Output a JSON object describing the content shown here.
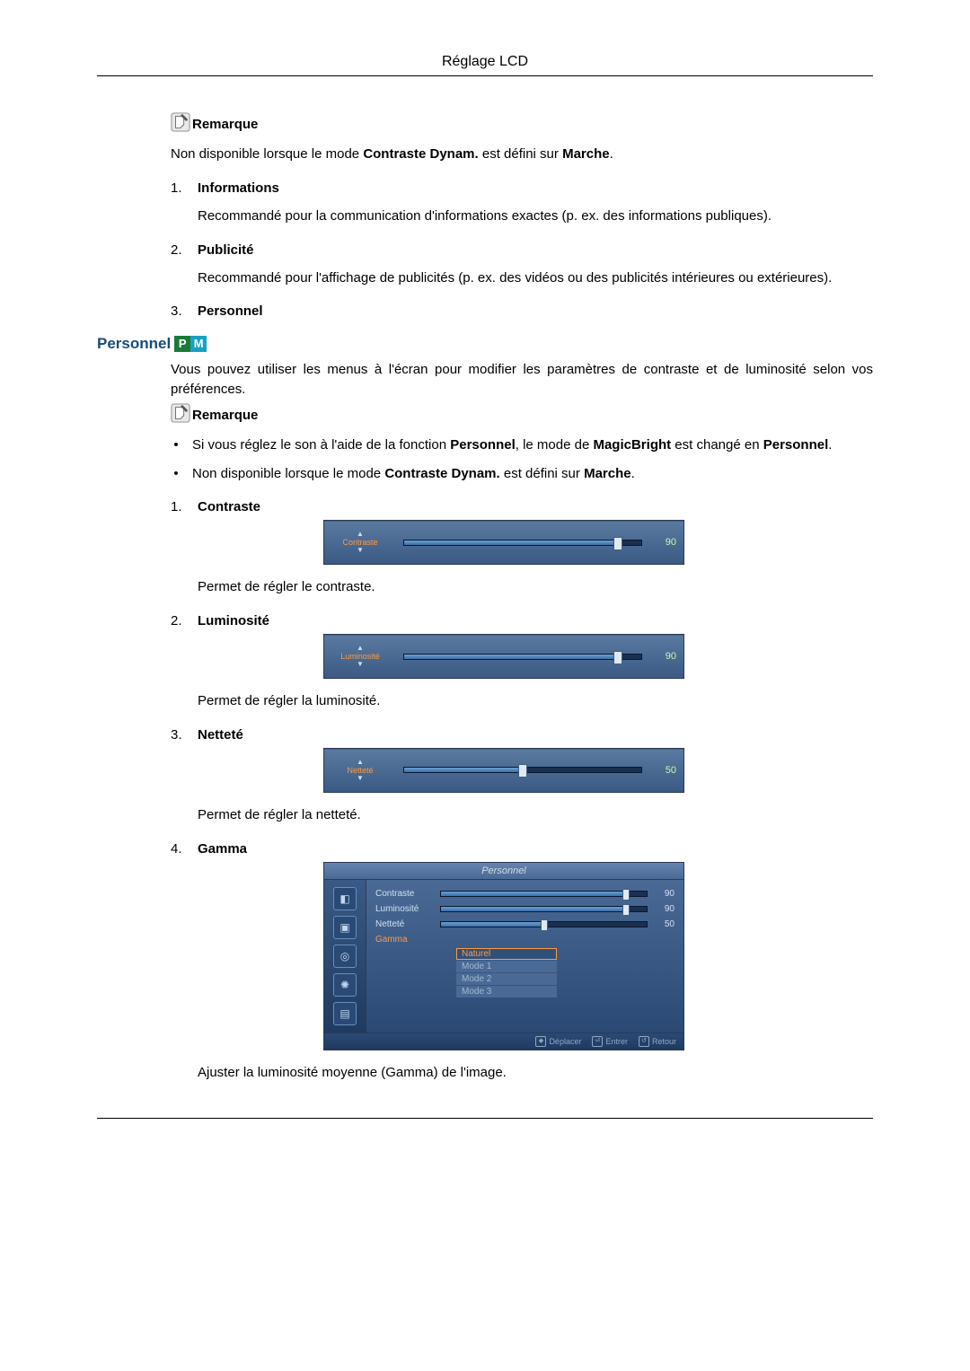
{
  "header": {
    "title": "Réglage LCD"
  },
  "remarque": {
    "label": "Remarque",
    "body": "Non disponible lorsque le mode <b>Contraste Dynam.</b> est défini sur <b>Marche</b>."
  },
  "list1": [
    {
      "num": "1.",
      "title": "Informations",
      "desc": "Recommandé pour la communication d'informations exactes (p. ex. des informations publiques)."
    },
    {
      "num": "2.",
      "title": "Publicité",
      "desc": "Recommandé pour l'affichage de publicités (p. ex. des vidéos ou des publicités intérieures ou extérieures)."
    },
    {
      "num": "3.",
      "title": "Personnel",
      "desc": ""
    }
  ],
  "personnel": {
    "heading": "Personnel",
    "badge_p": "P",
    "badge_m": "M",
    "intro": "Vous pouvez utiliser les menus à l'écran pour modifier les paramètres de contraste et de luminosité selon vos préférences.",
    "note_label": "Remarque",
    "bullets": [
      "Si vous réglez le son à l'aide de la fonction <b>Personnel</b>, le mode de <b>MagicBright</b> est changé en <b>Personnel</b>.",
      "Non disponible lorsque le mode <b>Contraste Dynam.</b> est défini sur <b>Marche</b>."
    ],
    "items": [
      {
        "num": "1.",
        "title": "Contraste",
        "osd_label": "Contraste",
        "value": "90",
        "desc": "Permet de régler le contraste."
      },
      {
        "num": "2.",
        "title": "Luminosité",
        "osd_label": "Luminosité",
        "value": "90",
        "desc": "Permet de régler la luminosité."
      },
      {
        "num": "3.",
        "title": "Netteté",
        "osd_label": "Netteté",
        "value": "50",
        "desc": "Permet de régler la netteté."
      },
      {
        "num": "4.",
        "title": "Gamma",
        "desc": "Ajuster la luminosité moyenne (Gamma) de l'image."
      }
    ]
  },
  "gamma_menu": {
    "title": "Personnel",
    "rows": [
      {
        "label": "Contraste",
        "value": "90"
      },
      {
        "label": "Luminosité",
        "value": "90"
      },
      {
        "label": "Netteté",
        "value": "50"
      }
    ],
    "gamma_label": "Gamma",
    "options": [
      "Naturel",
      "Mode 1",
      "Mode 2",
      "Mode 3"
    ],
    "footer": {
      "move": "Déplacer",
      "enter": "Entrer",
      "return": "Retour"
    }
  }
}
